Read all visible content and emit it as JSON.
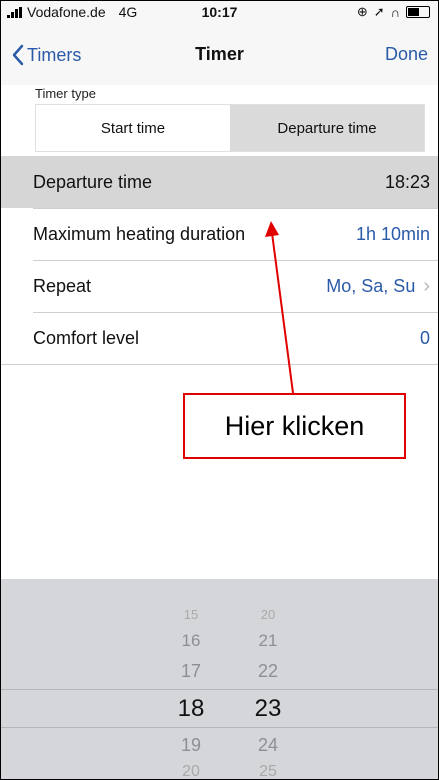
{
  "status_bar": {
    "carrier": "Vodafone.de",
    "network": "4G",
    "time": "10:17",
    "icons": [
      "lock-rotation-icon",
      "location-arrow-icon",
      "headphones-icon",
      "battery-icon"
    ]
  },
  "nav": {
    "back_label": "Timers",
    "title": "Timer",
    "done_label": "Done"
  },
  "timer_type": {
    "label": "Timer type",
    "options": [
      "Start time",
      "Departure time"
    ],
    "selected": "Departure time"
  },
  "rows": [
    {
      "label": "Departure time",
      "value": "18:23"
    },
    {
      "label": "Maximum heating duration",
      "value": "1h 10min"
    },
    {
      "label": "Repeat",
      "value": "Mo, Sa, Su"
    },
    {
      "label": "Comfort level",
      "value": "0"
    }
  ],
  "annotation": {
    "text": "Hier klicken",
    "color": "#e00000"
  },
  "picker": {
    "hours": [
      "15",
      "16",
      "17",
      "18",
      "19",
      "20"
    ],
    "minutes": [
      "20",
      "21",
      "22",
      "23",
      "24",
      "25"
    ],
    "selected_hour": "18",
    "selected_minute": "23"
  },
  "colors": {
    "accent": "#2a5aa8",
    "selected_row": "#d6d6d6",
    "picker_bg": "#d4d6da"
  }
}
